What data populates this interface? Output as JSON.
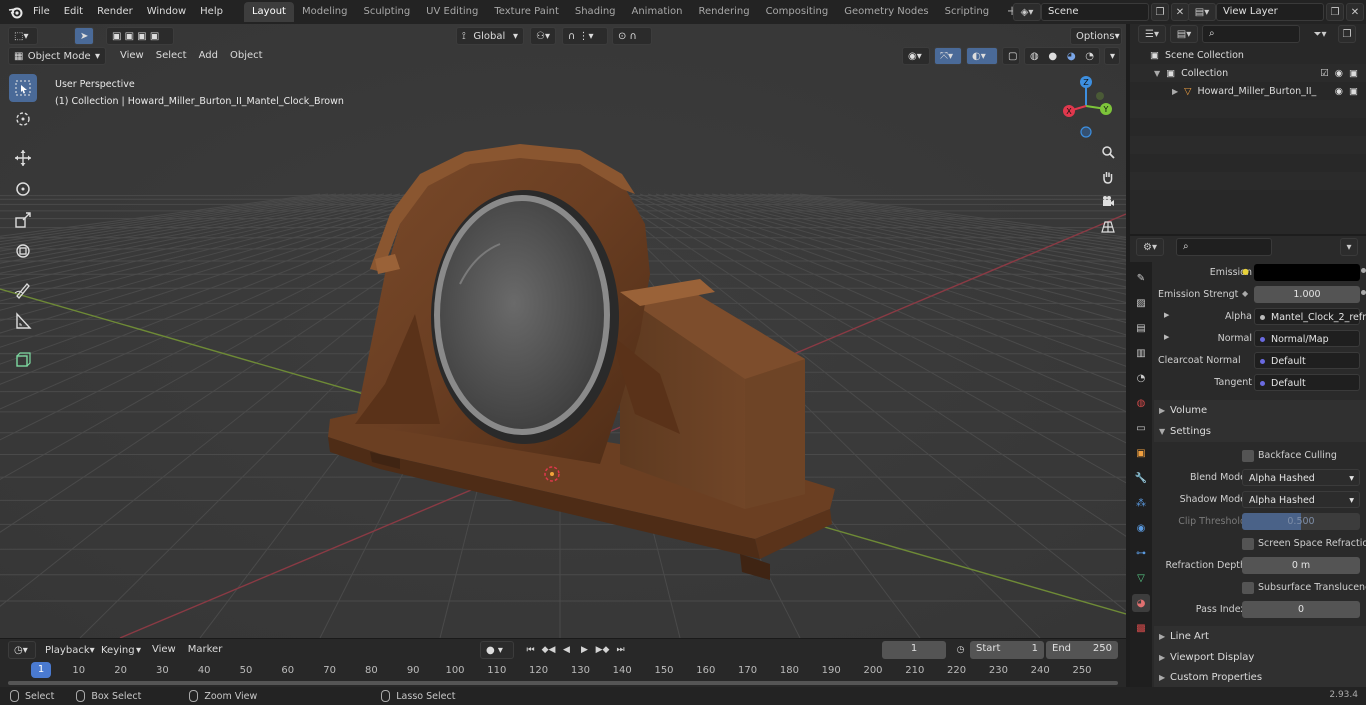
{
  "menu": [
    "File",
    "Edit",
    "Render",
    "Window",
    "Help"
  ],
  "workspaces": [
    "Layout",
    "Modeling",
    "Sculpting",
    "UV Editing",
    "Texture Paint",
    "Shading",
    "Animation",
    "Rendering",
    "Compositing",
    "Geometry Nodes",
    "Scripting"
  ],
  "active_workspace": "Layout",
  "scene": "Scene",
  "view_layer": "View Layer",
  "viewport": {
    "mode": "Object Mode",
    "menus": [
      "View",
      "Select",
      "Add",
      "Object"
    ],
    "transform": "Global",
    "options": "Options",
    "perspective": "User Perspective",
    "collection_info": "(1) Collection | Howard_Miller_Burton_II_Mantel_Clock_Brown",
    "gizmo": {
      "x": "X",
      "y": "Y",
      "z": "Z"
    }
  },
  "timeline": {
    "menus": [
      "Playback",
      "Keying",
      "View",
      "Marker"
    ],
    "current_frame": "1",
    "start_label": "Start",
    "start": "1",
    "end_label": "End",
    "end": "250",
    "ticks": [
      "1",
      "10",
      "20",
      "30",
      "40",
      "50",
      "60",
      "70",
      "80",
      "90",
      "100",
      "110",
      "120",
      "130",
      "140",
      "150",
      "160",
      "170",
      "180",
      "190",
      "200",
      "210",
      "220",
      "230",
      "240",
      "250"
    ]
  },
  "status": {
    "select": "Select",
    "box_select": "Box Select",
    "zoom_view": "Zoom View",
    "lasso_select": "Lasso Select",
    "version": "2.93.4"
  },
  "outliner": {
    "scene_collection": "Scene Collection",
    "collection": "Collection",
    "object": "Howard_Miller_Burton_II_"
  },
  "properties": {
    "emission_label": "Emission",
    "emission_strength_label": "Emission Strengt",
    "emission_strength": "1.000",
    "alpha_label": "Alpha",
    "alpha_value": "Mantel_Clock_2_refr...",
    "normal_label": "Normal",
    "normal_value": "Normal/Map",
    "clearcoat_label": "Clearcoat Normal",
    "clearcoat_value": "Default",
    "tangent_label": "Tangent",
    "tangent_value": "Default",
    "volume": "Volume",
    "settings": "Settings",
    "backface_culling": "Backface Culling",
    "blend_mode_label": "Blend Mode",
    "blend_mode": "Alpha Hashed",
    "shadow_mode_label": "Shadow Mode",
    "shadow_mode": "Alpha Hashed",
    "clip_threshold_label": "Clip Threshold",
    "clip_threshold": "0.500",
    "screen_space_refraction": "Screen Space Refraction",
    "refraction_depth_label": "Refraction Depth",
    "refraction_depth": "0 m",
    "subsurface_translucency": "Subsurface Translucency",
    "pass_index_label": "Pass Index",
    "pass_index": "0",
    "line_art": "Line Art",
    "viewport_display": "Viewport Display",
    "custom_properties": "Custom Properties"
  },
  "colors": {
    "accent": "#4a7ad0",
    "x_axis": "#e0384d",
    "y_axis": "#7dc43a",
    "z_axis": "#3d8fe0"
  }
}
